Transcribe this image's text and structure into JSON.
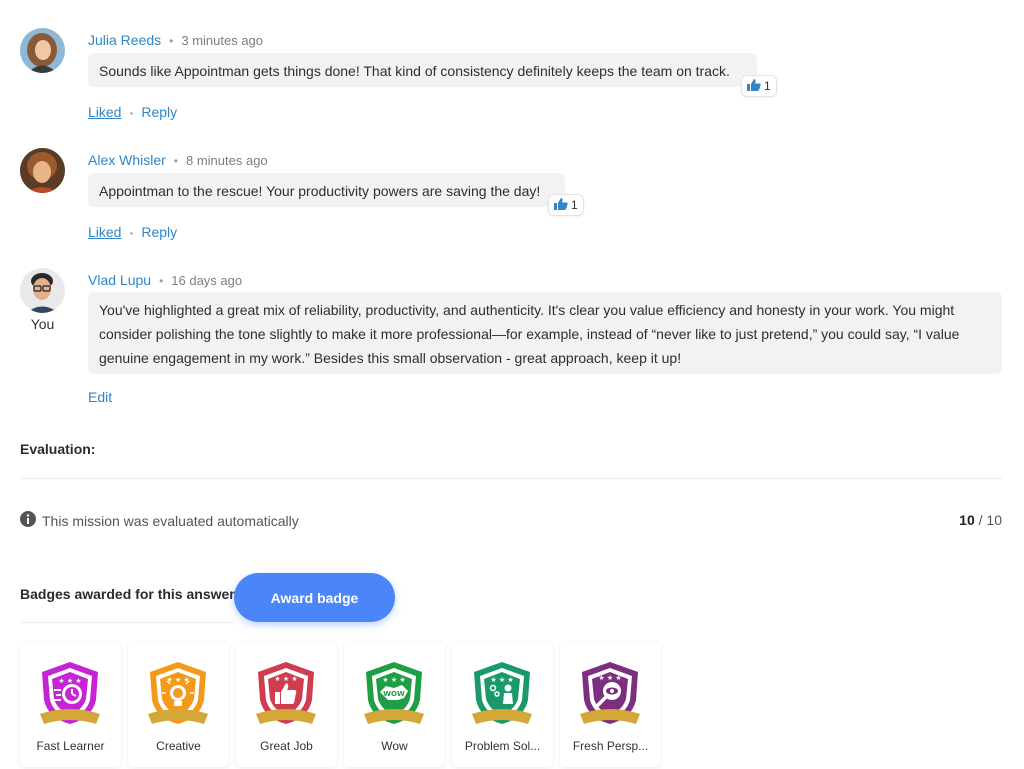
{
  "comments": [
    {
      "author": "Julia Reeds",
      "time": "3 minutes ago",
      "text": "Sounds like Appointman gets things done! That kind of consistency definitely keeps the team on track.",
      "likes": "1",
      "liked_label": "Liked",
      "reply_label": "Reply"
    },
    {
      "author": "Alex Whisler",
      "time": "8 minutes ago",
      "text": "Appointman to the rescue! Your productivity powers are saving the day!",
      "likes": "1",
      "liked_label": "Liked",
      "reply_label": "Reply"
    },
    {
      "author": "Vlad Lupu",
      "time": "16 days ago",
      "you_label": "You",
      "text": "You've highlighted a great mix of reliability, productivity, and authenticity. It's clear you value efficiency and honesty in your work. You might consider polishing the tone slightly to make it more professional—for example, instead of “never like to just pretend,” you could say, “I value genuine engagement in my work.” Besides this small observation - great approach, keep it up!",
      "edit_label": "Edit"
    }
  ],
  "evaluation": {
    "title": "Evaluation:",
    "info": "This mission was evaluated automatically",
    "score": "10",
    "score_sep": " / ",
    "max": "10"
  },
  "badges": {
    "title": "Badges awarded for this answer",
    "award_button": "Award badge",
    "items": [
      {
        "name": "Fast Learner",
        "color": "#c623d6",
        "icon": "stopwatch-icon"
      },
      {
        "name": "Creative",
        "color": "#f39a1b",
        "icon": "lightbulb-icon"
      },
      {
        "name": "Great Job",
        "color": "#cf3d4e",
        "icon": "thumbs-up-icon"
      },
      {
        "name": "Wow",
        "color": "#1e9e45",
        "icon": "wow-bubble-icon"
      },
      {
        "name": "Problem Sol...",
        "color": "#1a9a6a",
        "icon": "presenter-icon"
      },
      {
        "name": "Fresh Persp...",
        "color": "#7b2f7e",
        "icon": "magnifier-eye-icon"
      }
    ]
  },
  "colors": {
    "link": "#2e86c9",
    "button": "#4a86f7",
    "bubble": "#f2f2f2"
  }
}
